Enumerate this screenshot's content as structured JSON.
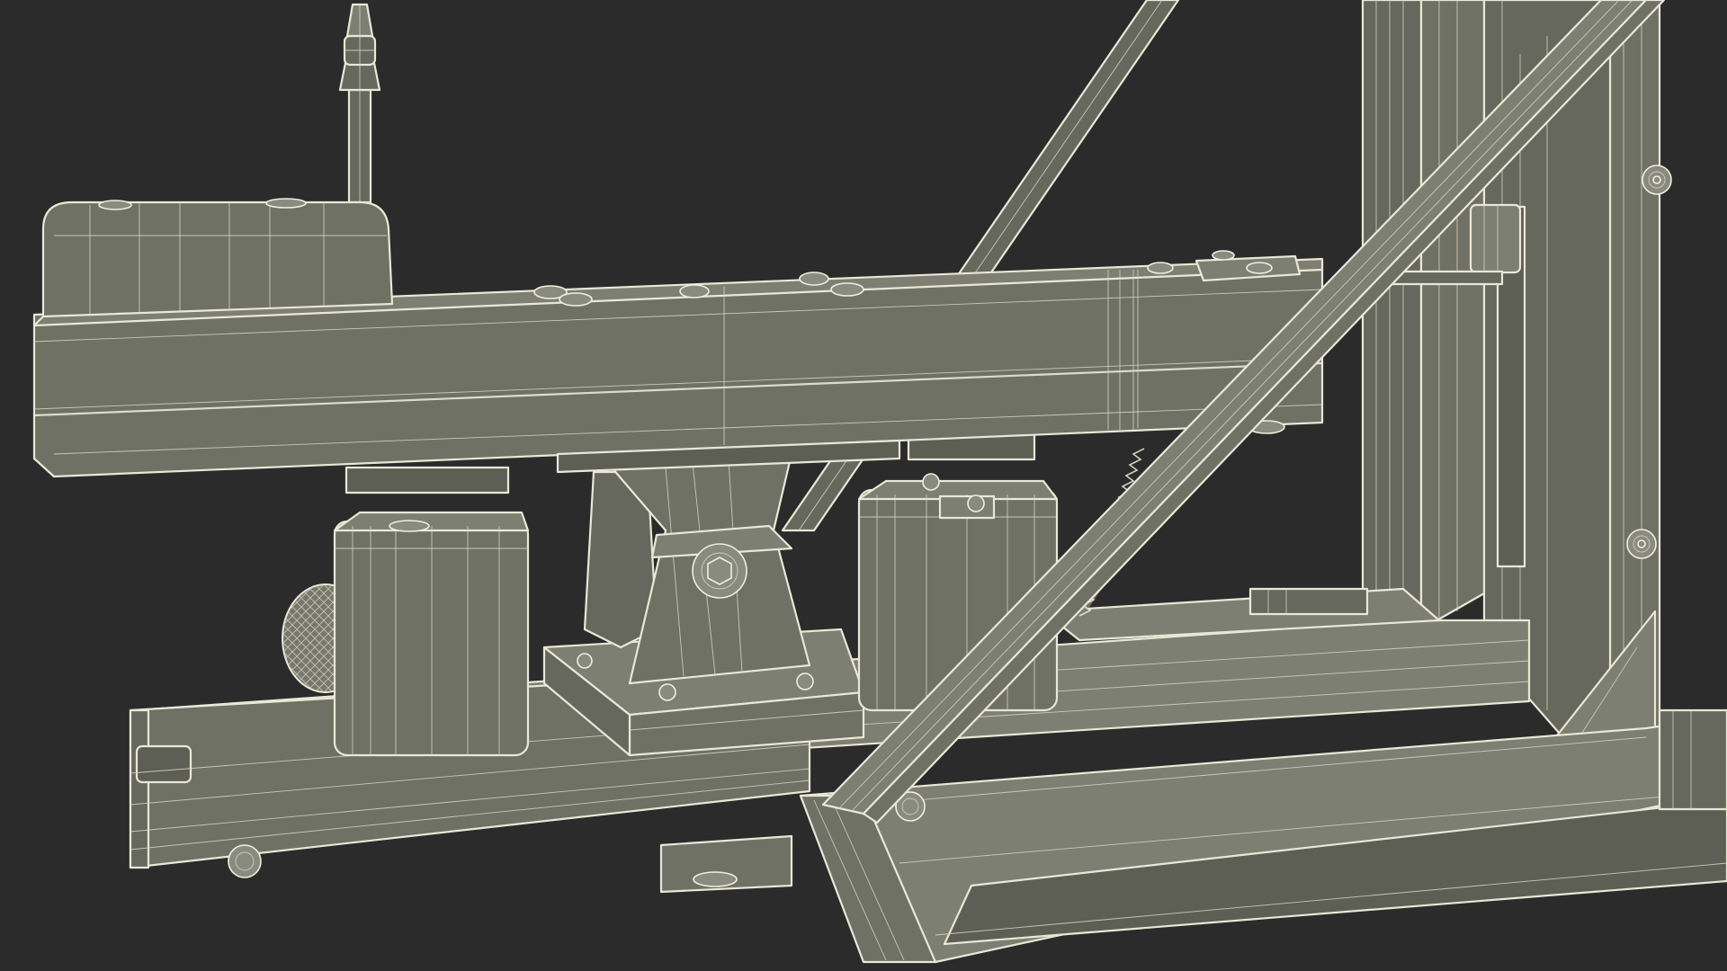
{
  "scene": {
    "subject": "wireframe-render-of-mechanical-frame-assembly",
    "background_color": "#2b2b2b",
    "surface_color": "#6f7165",
    "wire_color": "#e9e7d6",
    "render_style": "gray-shaded-with-white-wireframe"
  }
}
